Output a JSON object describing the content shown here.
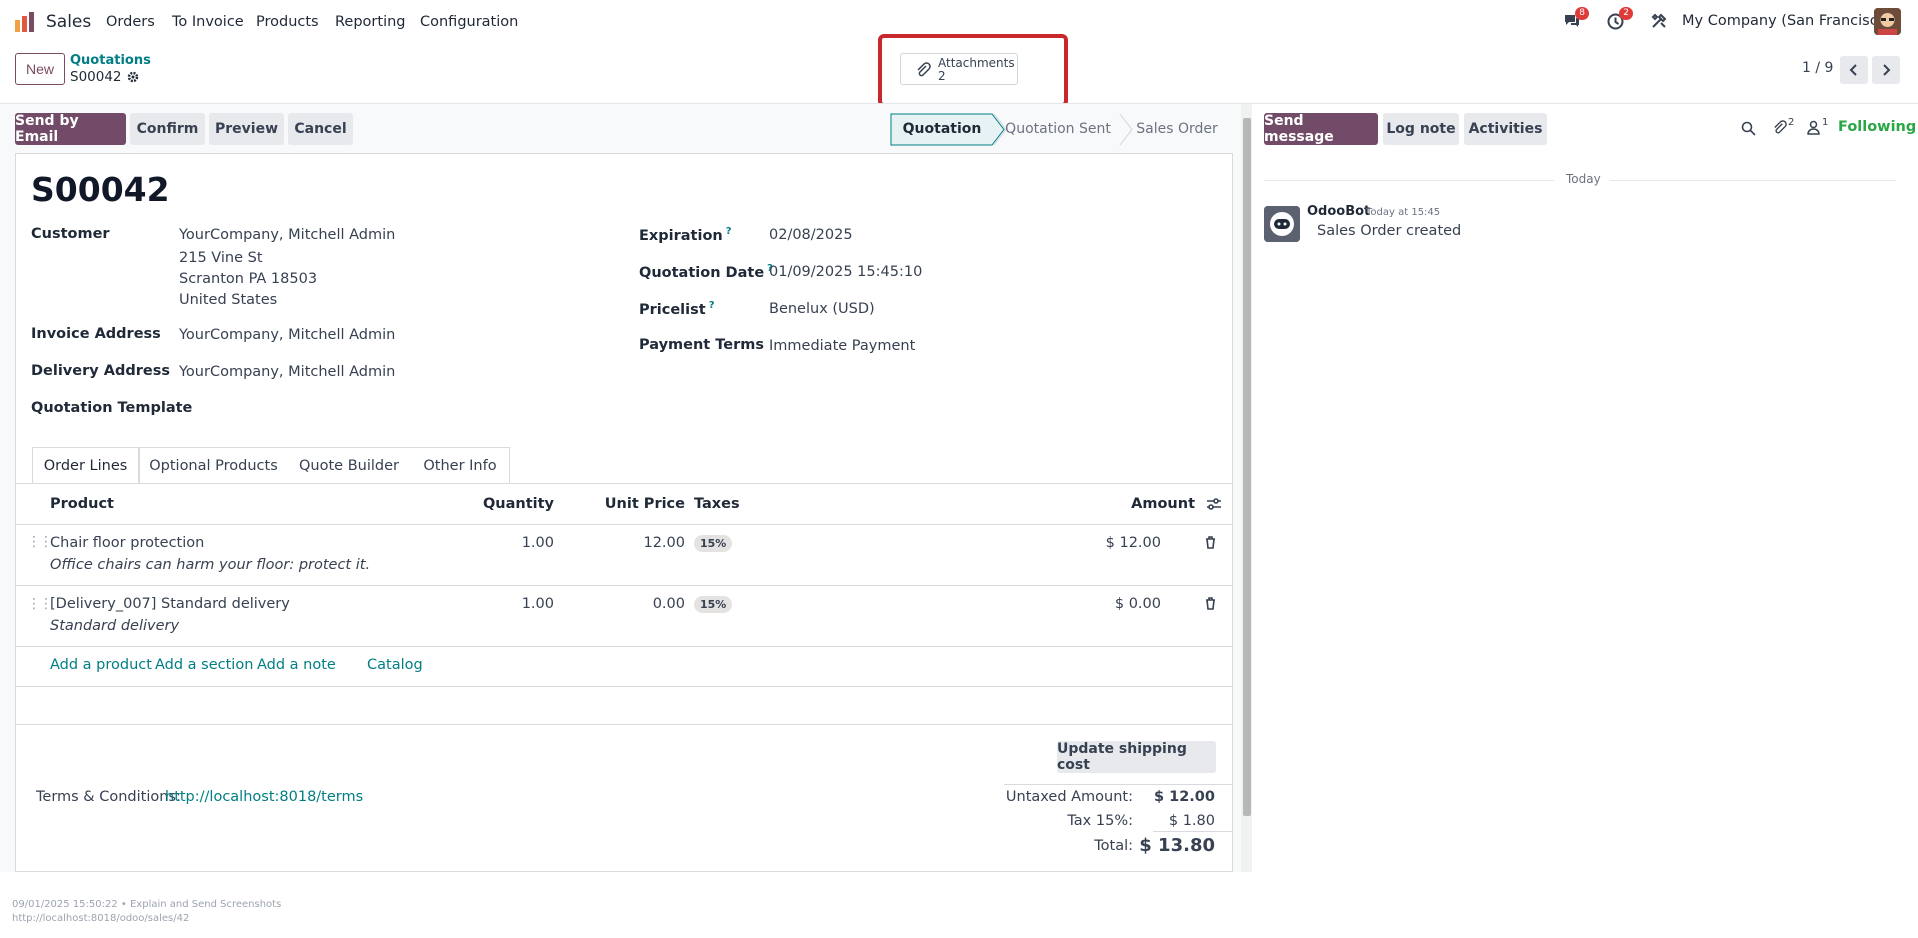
{
  "app": {
    "name": "Sales"
  },
  "menu": [
    "Orders",
    "To Invoice",
    "Products",
    "Reporting",
    "Configuration"
  ],
  "nav": {
    "messages_count": "8",
    "activities_count": "2",
    "company": "My Company (San Francisco)"
  },
  "control": {
    "new_label": "New",
    "breadcrumb_parent": "Quotations",
    "breadcrumb_current": "S00042",
    "attachments_label": "Attachments",
    "attachments_count": "2",
    "pager": "1 / 9"
  },
  "actions": {
    "send_email": "Send by Email",
    "confirm": "Confirm",
    "preview": "Preview",
    "cancel": "Cancel"
  },
  "statusbar": {
    "steps": [
      "Quotation",
      "Quotation Sent",
      "Sales Order"
    ],
    "active": "Quotation"
  },
  "form": {
    "title": "S00042",
    "customer_label": "Customer",
    "customer_lines": [
      "YourCompany, Mitchell Admin",
      "215 Vine St",
      "Scranton PA 18503",
      "United States"
    ],
    "invoice_address_label": "Invoice Address",
    "invoice_address": "YourCompany, Mitchell Admin",
    "delivery_address_label": "Delivery Address",
    "delivery_address": "YourCompany, Mitchell Admin",
    "template_label": "Quotation Template",
    "expiration_label": "Expiration",
    "expiration": "02/08/2025",
    "quotation_date_label": "Quotation Date",
    "quotation_date": "01/09/2025 15:45:10",
    "pricelist_label": "Pricelist",
    "pricelist": "Benelux (USD)",
    "payment_terms_label": "Payment Terms",
    "payment_terms": "Immediate Payment",
    "help_mark": "?"
  },
  "tabs": [
    "Order Lines",
    "Optional Products",
    "Quote Builder",
    "Other Info"
  ],
  "table": {
    "headers": {
      "product": "Product",
      "quantity": "Quantity",
      "unit_price": "Unit Price",
      "taxes": "Taxes",
      "amount": "Amount"
    },
    "rows": [
      {
        "product": "Chair floor protection",
        "description": "Office chairs can harm your floor: protect it.",
        "quantity": "1.00",
        "unit_price": "12.00",
        "tax": "15%",
        "amount": "$ 12.00"
      },
      {
        "product": "[Delivery_007] Standard delivery",
        "description": "Standard delivery",
        "quantity": "1.00",
        "unit_price": "0.00",
        "tax": "15%",
        "amount": "$ 0.00"
      }
    ],
    "add_product": "Add a product",
    "add_section": "Add a section",
    "add_note": "Add a note",
    "catalog": "Catalog"
  },
  "totals": {
    "update_shipping": "Update shipping cost",
    "untaxed_label": "Untaxed Amount:",
    "untaxed": "$ 12.00",
    "tax_label": "Tax 15%:",
    "tax": "$ 1.80",
    "total_label": "Total:",
    "total": "$ 13.80"
  },
  "terms": {
    "label": "Terms & Conditions:",
    "link": "http://localhost:8018/terms"
  },
  "chatter": {
    "send_message": "Send message",
    "log_note": "Log note",
    "activities": "Activities",
    "attachments_count": "2",
    "followers_count": "1",
    "following": "Following",
    "today": "Today",
    "author": "OdooBot",
    "time": "Today at 15:45",
    "message": "Sales Order created"
  },
  "footer": {
    "line1": "09/01/2025 15:50:22 • Explain and Send Screenshots",
    "line2": "http://localhost:8018/odoo/sales/42"
  },
  "colors": {
    "primary": "#714b67",
    "link": "#017e84",
    "following": "#28a745",
    "highlight_box": "#c8272b"
  }
}
